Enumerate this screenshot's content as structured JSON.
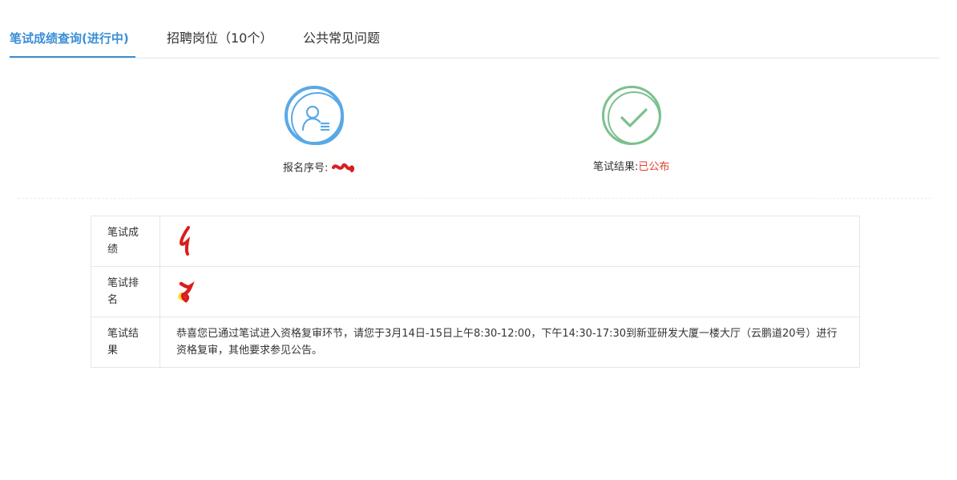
{
  "tabs": [
    {
      "label": "笔试成绩查询(进行中)",
      "active": true
    },
    {
      "label": "招聘岗位（10个）",
      "active": false
    },
    {
      "label": "公共常见问题",
      "active": false
    }
  ],
  "status": {
    "registration": {
      "label": "报名序号:",
      "icon": "user-list-icon",
      "color": "#5aa9e6"
    },
    "exam_result": {
      "label": "笔试结果:",
      "value": "已公布",
      "icon": "check-icon",
      "color": "#7cc08e",
      "value_color": "#e0412f"
    }
  },
  "table": {
    "rows": [
      {
        "label": "笔试成绩",
        "value": ""
      },
      {
        "label": "笔试排名",
        "value": ""
      },
      {
        "label": "笔试结果",
        "value": "恭喜您已通过笔试进入资格复审环节，请您于3月14日-15日上午8:30-12:00，下午14:30-17:30到新亚研发大厦一楼大厅（云鹏道20号）进行资格复审，其他要求参见公告。"
      }
    ]
  },
  "colors": {
    "accent": "#3a8fd6",
    "redaction": "#d81e1e"
  }
}
